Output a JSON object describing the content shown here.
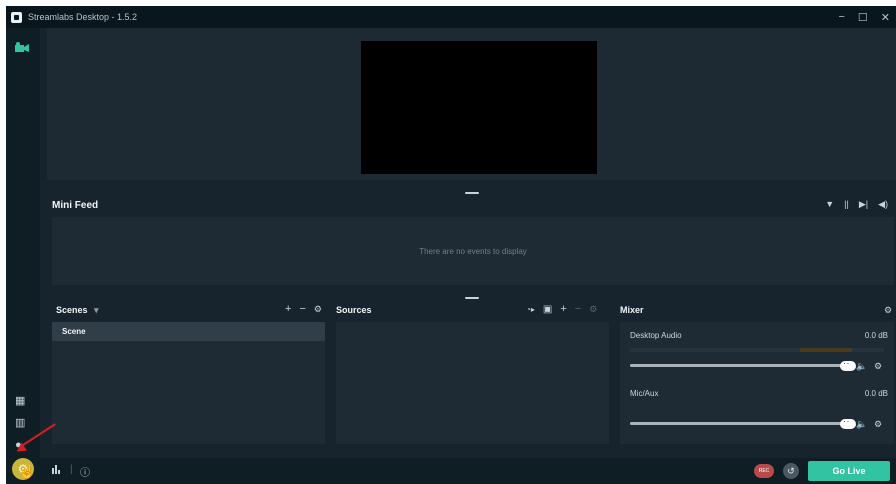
{
  "window": {
    "title": "Streamlabs Desktop - 1.5.2",
    "controls": {
      "minimize": "−",
      "maximize": "☐",
      "close": "✕"
    }
  },
  "sidebar": {
    "top_icon": "studio-video-icon",
    "bottom_icons": [
      "layout-editor-icon",
      "columns-icon",
      "help-icon"
    ],
    "settings_icon": "⚙"
  },
  "preview": {
    "canvas_color": "#000000"
  },
  "mini_feed": {
    "title": "Mini Feed",
    "empty_text": "There are no events to display",
    "tools": [
      "▼",
      "||",
      "▶|",
      "◀)"
    ]
  },
  "scenes": {
    "title": "Scenes",
    "dropdown": "▾",
    "tools": {
      "add": "+",
      "remove": "−",
      "settings": "⚙"
    },
    "items": [
      {
        "label": "Scene"
      }
    ]
  },
  "sources": {
    "title": "Sources",
    "tools": {
      "group": "◔▸",
      "folder": "▣",
      "add": "+",
      "remove": "−",
      "settings": "⚙"
    }
  },
  "mixer": {
    "title": "Mixer",
    "settings_icon": "⚙",
    "channels": [
      {
        "name": "Desktop Audio",
        "level": "0.0 dB",
        "volume_fraction": 1.0
      },
      {
        "name": "Mic/Aux",
        "level": "0.0 dB",
        "volume_fraction": 1.0
      }
    ],
    "mute_icon": "🔈",
    "gear_icon": "⚙"
  },
  "footer": {
    "stats_icon": "📊",
    "info_icon": "ⓘ",
    "rec_label": "REC",
    "replay_icon": "↺",
    "go_live_label": "Go Live"
  },
  "colors": {
    "accent": "#31c3a2",
    "background": "#17242d",
    "panel": "#1e2b35",
    "settings_highlight": "#c8b63a",
    "annotation": "#d41f1f"
  }
}
